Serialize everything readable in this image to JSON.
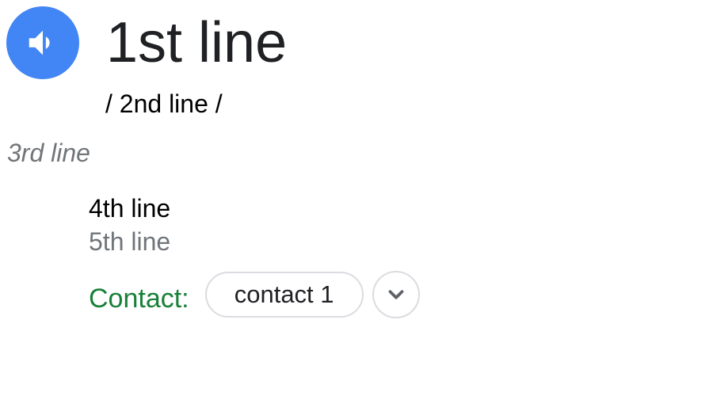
{
  "pronunciation": {
    "speaker_icon": "speaker-icon",
    "accent_color": "#4285f4"
  },
  "lines": {
    "line1": "1st line",
    "line2": "/ 2nd line /",
    "line3": "3rd line",
    "line4": "4th line",
    "line5": "5th line"
  },
  "contact": {
    "label": "Contact:",
    "label_color": "#188038",
    "chips": [
      "contact 1"
    ],
    "expand_icon": "chevron-down-icon"
  }
}
